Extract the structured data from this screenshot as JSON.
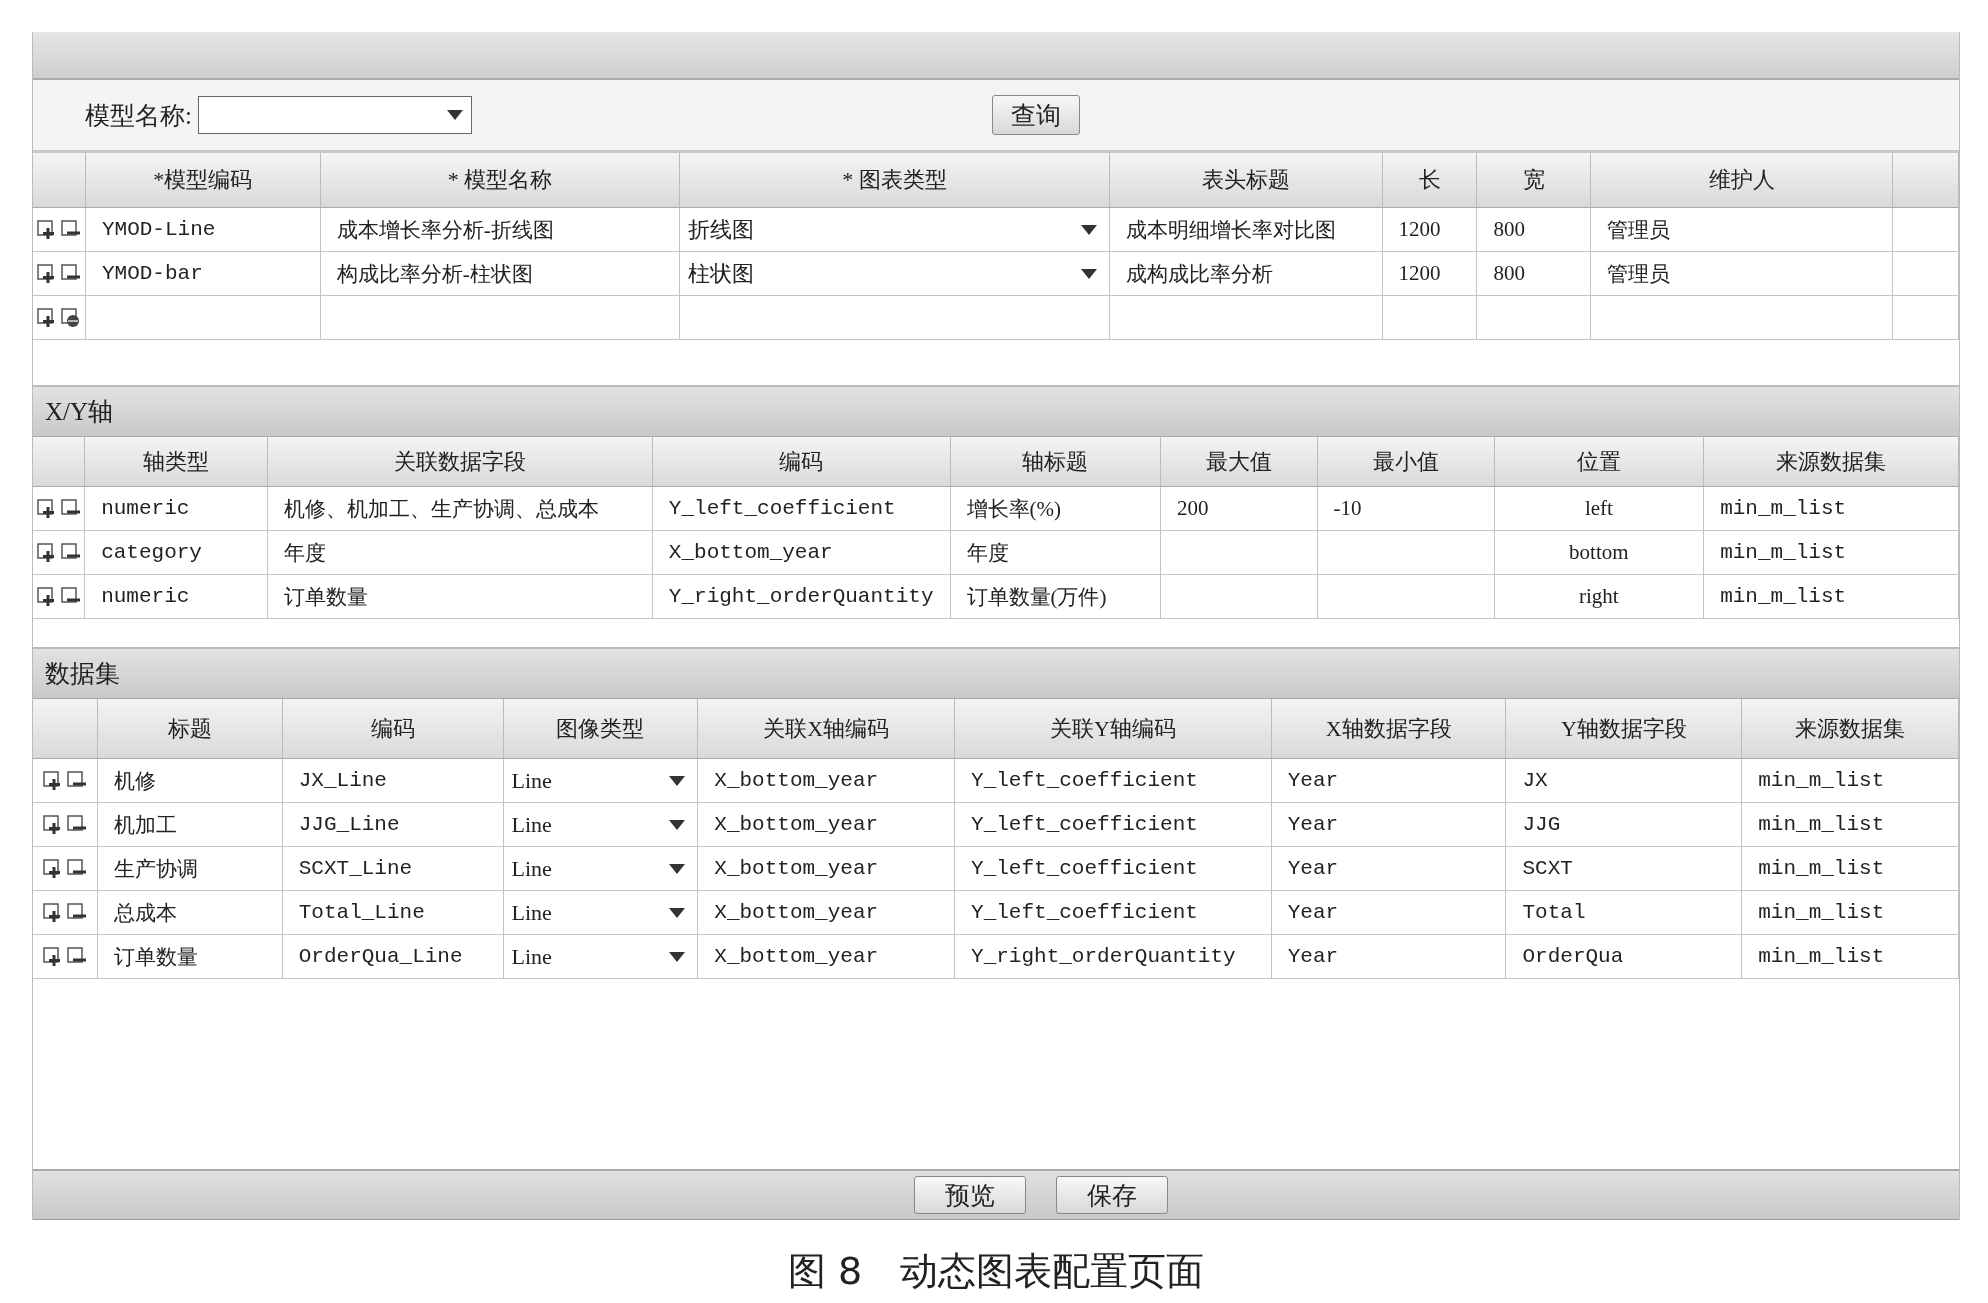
{
  "search": {
    "label": "模型名称:",
    "query_button": "查询"
  },
  "models": {
    "columns": [
      {
        "label": "*模型编码",
        "kind": "mono"
      },
      {
        "label": "* 模型名称",
        "kind": "text"
      },
      {
        "label": "* 图表类型",
        "kind": "select"
      },
      {
        "label": "表头标题",
        "kind": "text"
      },
      {
        "label": "长",
        "kind": "text"
      },
      {
        "label": "宽",
        "kind": "text"
      },
      {
        "label": "维护人",
        "kind": "text"
      }
    ],
    "rows": [
      {
        "kind": "record",
        "cells": [
          "YMOD-Line",
          "成本增长率分析-折线图",
          "折线图",
          "成本明细增长率对比图",
          "1200",
          "800",
          "管理员"
        ]
      },
      {
        "kind": "record",
        "cells": [
          "YMOD-bar",
          "构成比率分析-柱状图",
          "柱状图",
          "成构成比率分析",
          "1200",
          "800",
          "管理员"
        ]
      },
      {
        "kind": "new",
        "cells": []
      }
    ]
  },
  "axes": {
    "title": "X/Y轴",
    "columns": [
      {
        "label": "轴类型",
        "kind": "mono"
      },
      {
        "label": "关联数据字段",
        "kind": "text"
      },
      {
        "label": "编码",
        "kind": "mono"
      },
      {
        "label": "轴标题",
        "kind": "text"
      },
      {
        "label": "最大值",
        "kind": "text"
      },
      {
        "label": "最小值",
        "kind": "text"
      },
      {
        "label": "位置",
        "kind": "center"
      },
      {
        "label": "来源数据集",
        "kind": "mono"
      }
    ],
    "rows": [
      {
        "kind": "record",
        "cells": [
          "numeric",
          "机修、机加工、生产协调、总成本",
          "Y_left_coefficient",
          "增长率(%)",
          "200",
          "-10",
          "left",
          "min_m_list"
        ]
      },
      {
        "kind": "record",
        "cells": [
          "category",
          "年度",
          "X_bottom_year",
          "年度",
          null,
          null,
          "bottom",
          "min_m_list"
        ]
      },
      {
        "kind": "record",
        "cells": [
          "numeric",
          "订单数量",
          "Y_right_orderQuantity",
          "订单数量(万件)",
          null,
          null,
          "right",
          "min_m_list"
        ]
      }
    ]
  },
  "datasets": {
    "title": "数据集",
    "columns": [
      {
        "label": "标题",
        "kind": "text"
      },
      {
        "label": "编码",
        "kind": "mono"
      },
      {
        "label": "图像类型",
        "kind": "select"
      },
      {
        "label": "关联X轴编码",
        "kind": "mono"
      },
      {
        "label": "关联Y轴编码",
        "kind": "mono"
      },
      {
        "label": "X轴数据字段",
        "kind": "mono"
      },
      {
        "label": "Y轴数据字段",
        "kind": "mono"
      },
      {
        "label": "来源数据集",
        "kind": "mono"
      }
    ],
    "rows": [
      {
        "kind": "record",
        "cells": [
          "机修",
          "JX_Line",
          "Line",
          "X_bottom_year",
          "Y_left_coefficient",
          "Year",
          "JX",
          "min_m_list"
        ]
      },
      {
        "kind": "record",
        "cells": [
          "机加工",
          "JJG_Line",
          "Line",
          "X_bottom_year",
          "Y_left_coefficient",
          "Year",
          "JJG",
          "min_m_list"
        ]
      },
      {
        "kind": "record",
        "cells": [
          "生产协调",
          "SCXT_Line",
          "Line",
          "X_bottom_year",
          "Y_left_coefficient",
          "Year",
          "SCXT",
          "min_m_list"
        ]
      },
      {
        "kind": "record",
        "cells": [
          "总成本",
          "Total_Line",
          "Line",
          "X_bottom_year",
          "Y_left_coefficient",
          "Year",
          "Total",
          "min_m_list"
        ]
      },
      {
        "kind": "record",
        "cells": [
          "订单数量",
          "OrderQua_Line",
          "Line",
          "X_bottom_year",
          "Y_right_orderQuantity",
          "Year",
          "OrderQua",
          "min_m_list"
        ]
      }
    ]
  },
  "footer": {
    "buttons": [
      "预览",
      "保存"
    ]
  },
  "caption": "图 8　动态图表配置页面"
}
